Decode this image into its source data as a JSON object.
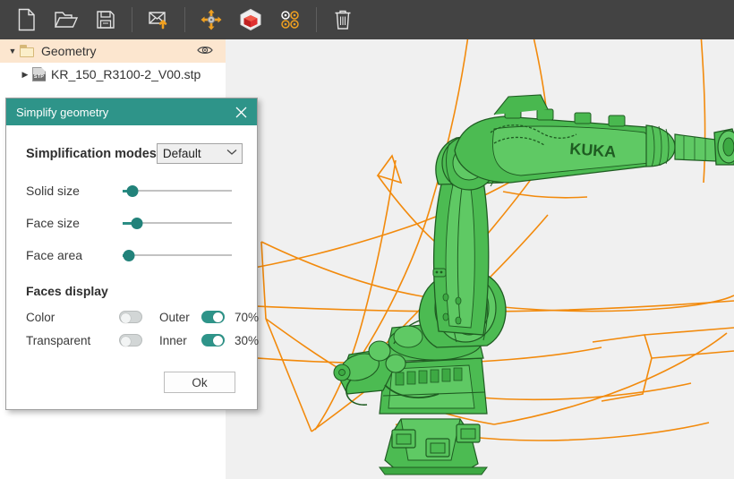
{
  "toolbar": {
    "items": [
      {
        "name": "new-file-icon",
        "title": "New"
      },
      {
        "name": "open-folder-icon",
        "title": "Open"
      },
      {
        "name": "save-disk-icon",
        "title": "Save"
      },
      {
        "name": "import-geometry-icon",
        "title": "Import geometry"
      },
      {
        "name": "move-tool-icon",
        "title": "Move"
      },
      {
        "name": "solid-box-icon",
        "title": "Solid"
      },
      {
        "name": "targets-grid-icon",
        "title": "Targets"
      },
      {
        "name": "delete-trash-icon",
        "title": "Delete"
      }
    ]
  },
  "tree": {
    "root": {
      "label": "Geometry",
      "expanded": true,
      "selected": true
    },
    "children": [
      {
        "label": "KR_150_R3100-2_V00.stp",
        "expanded": false,
        "file_type": "STP"
      }
    ]
  },
  "dialog": {
    "title": "Simplify geometry",
    "close_label": "×",
    "modes": {
      "label": "Simplification modes",
      "selected": "Default",
      "options": [
        "Default"
      ]
    },
    "sliders": [
      {
        "label": "Solid size",
        "value": 9
      },
      {
        "label": "Face size",
        "value": 13
      },
      {
        "label": "Face area",
        "value": 6
      }
    ],
    "faces_display": {
      "title": "Faces display",
      "rows": [
        {
          "name": "Color",
          "left_on": false,
          "mid": "Outer",
          "right_on": true,
          "percent": "70%"
        },
        {
          "name": "Transparent",
          "left_on": false,
          "mid": "Inner",
          "right_on": true,
          "percent": "30%"
        }
      ]
    },
    "ok_label": "Ok"
  },
  "viewport": {
    "model_name": "KUKA",
    "background": "#f0f0f0",
    "model_color": "#4cbb52",
    "envelope_color": "#f28a0c"
  },
  "colors": {
    "toolbar_bg": "#434343",
    "accent_teal": "#2e9489",
    "accent_orange": "#f0a020",
    "tree_selection": "#fce6cf"
  }
}
